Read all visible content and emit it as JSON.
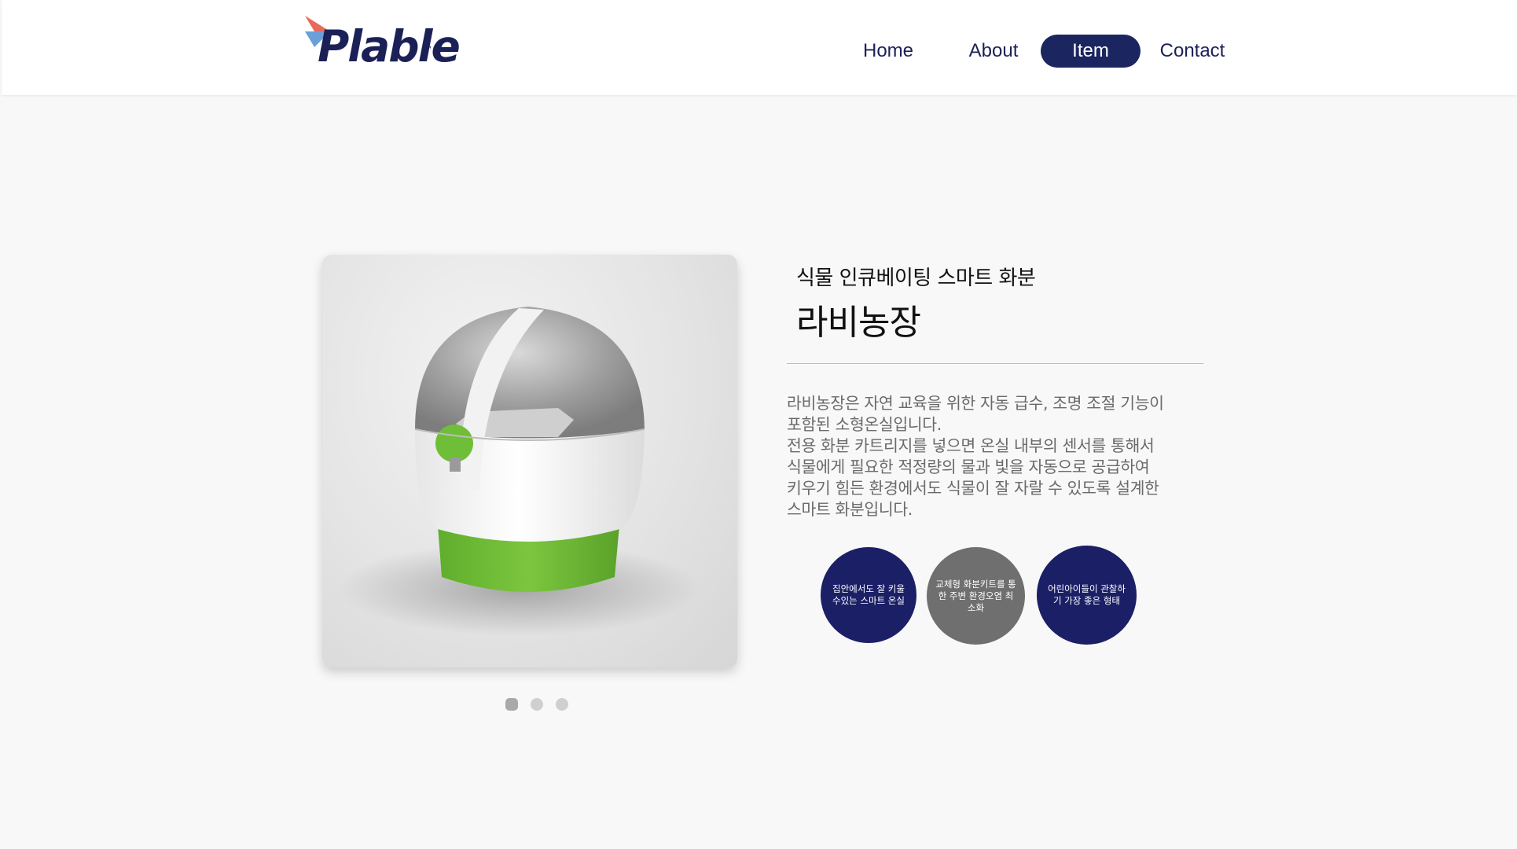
{
  "brand": {
    "name": "Plable",
    "tm": "™",
    "colors": {
      "navy": "#1b2157",
      "flag_red": "#e86a5a",
      "flag_blue": "#6aa0d8"
    }
  },
  "nav": {
    "items": [
      {
        "label": "Home",
        "active": false
      },
      {
        "label": "About",
        "active": false
      },
      {
        "label": "Item",
        "active": true
      },
      {
        "label": "Contact",
        "active": false
      }
    ]
  },
  "carousel": {
    "image_alt": "smart-pot-product-image",
    "slide_count": 3,
    "active_index": 0
  },
  "product": {
    "subtitle": "식물 인큐베이팅 스마트 화분",
    "title": "라비농장",
    "description_lines": [
      "라비농장은 자연 교육을 위한 자동 급수, 조명 조절 기능이",
      "포함된 소형온실입니다.",
      "전용 화분 카트리지를 넣으면 온실 내부의 센서를 통해서",
      "식물에게 필요한 적정량의 물과 빛을 자동으로 공급하여",
      "키우기 힘든 환경에서도 식물이 잘 자랄 수 있도록 설계한",
      "스마트 화분입니다."
    ],
    "features": [
      {
        "text": "집안에서도 잘 키울수있는 스마트 온실",
        "color": "#1b1f66"
      },
      {
        "text": "교체형 화분키트를 통한 주변 환경오염 최소화",
        "color": "#6f6f6f"
      },
      {
        "text": "어린아이들이 관찰하기 가장 좋은 형태",
        "color": "#1b1f66"
      }
    ]
  }
}
